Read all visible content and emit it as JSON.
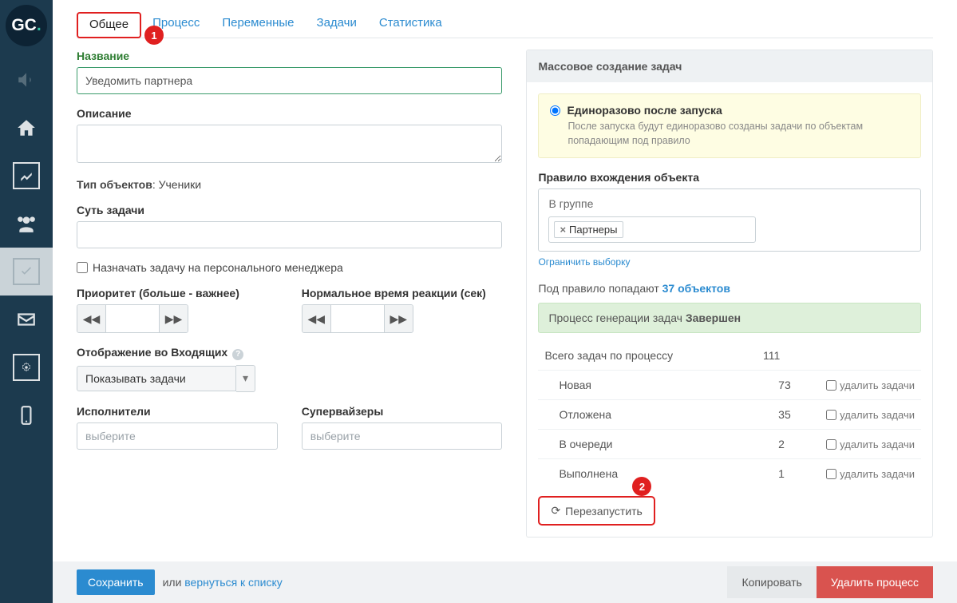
{
  "logo": {
    "g": "G",
    "c": "C",
    "dot": "."
  },
  "tabs": {
    "general": "Общее",
    "process": "Процесс",
    "vars": "Переменные",
    "tasks": "Задачи",
    "stats": "Статистика"
  },
  "badges": {
    "tab": "1",
    "restart": "2"
  },
  "labels": {
    "name": "Название",
    "desc": "Описание",
    "obj_type_label": "Тип объектов",
    "obj_type_sep": ": ",
    "obj_type_value": "Ученики",
    "essence": "Суть задачи",
    "assign_pm": "Назначать задачу на персонального менеджера",
    "priority": "Приоритет (больше - важнее)",
    "reaction": "Нормальное время реакции (сек)",
    "inbox": "Отображение во Входящих",
    "executors": "Исполнители",
    "supervisors": "Супервайзеры",
    "select_placeholder": "выберите"
  },
  "inputs": {
    "name_value": "Уведомить партнера",
    "show_tasks": "Показывать задачи"
  },
  "panel": {
    "header": "Массовое создание задач",
    "radio_label": "Единоразово после запуска",
    "radio_desc": "После запуска будут единоразово созданы задачи по объектам попадающим под правило",
    "rule_title": "Правило вхождения объекта",
    "rule_group": "В группе",
    "rule_tag": "Партнеры",
    "limit": "Ограничить выборку",
    "under_rule_pre": "Под правило попадают ",
    "under_rule_link": "37 объектов",
    "gen_status_pre": "Процесс генерации задач ",
    "gen_status_bold": "Завершен",
    "total_label": "Всего задач по процессу",
    "total_val": "111",
    "rows": [
      {
        "name": "Новая",
        "val": "73",
        "del": "удалить задачи"
      },
      {
        "name": "Отложена",
        "val": "35",
        "del": "удалить задачи"
      },
      {
        "name": "В очереди",
        "val": "2",
        "del": "удалить задачи"
      },
      {
        "name": "Выполнена",
        "val": "1",
        "del": "удалить задачи"
      }
    ],
    "restart": "Перезапустить"
  },
  "footer": {
    "save": "Сохранить",
    "or": "или ",
    "back": "вернуться к списку",
    "copy": "Копировать",
    "delete": "Удалить процесс"
  }
}
